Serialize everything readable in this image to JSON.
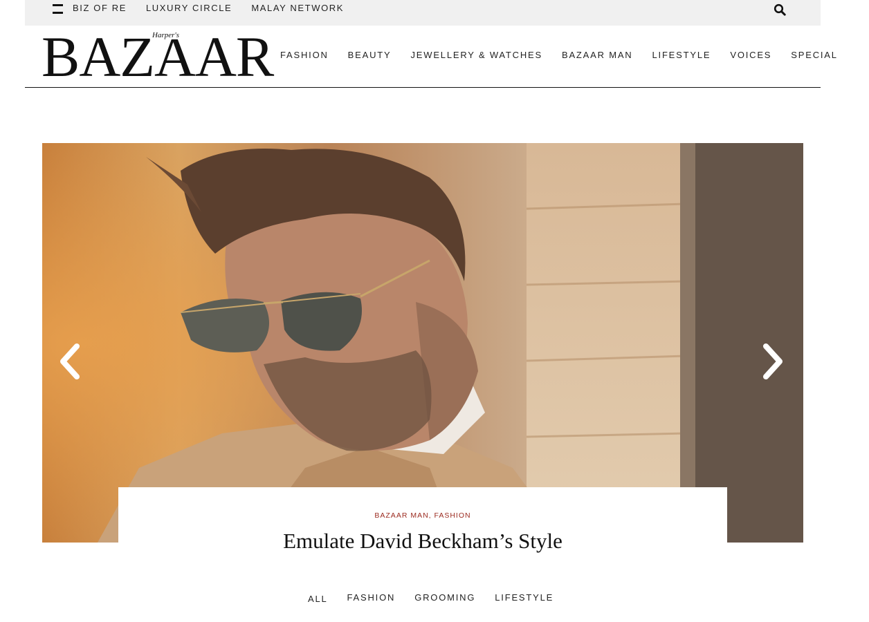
{
  "topbar": {
    "links": [
      "BIZ OF RE",
      "LUXURY CIRCLE",
      "MALAY NETWORK"
    ]
  },
  "logo": {
    "main": "BAZAAR",
    "sub": "Harper's"
  },
  "nav": {
    "items": [
      "FASHION",
      "BEAUTY",
      "JEWELLERY & WATCHES",
      "BAZAAR MAN",
      "LIFESTYLE",
      "VOICES",
      "SPECIAL"
    ]
  },
  "hero": {
    "categories": [
      "BAZAAR MAN",
      "FASHION"
    ],
    "category_separator": ",",
    "title": "Emulate David Beckham’s Style"
  },
  "filters": {
    "items": [
      "ALL",
      "FASHION",
      "GROOMING",
      "LIFESTYLE"
    ],
    "active": "ALL"
  },
  "colors": {
    "topbar_bg": "#f0f0f0",
    "category_accent": "#9b2a1f",
    "text": "#111111"
  },
  "icons": {
    "menu": "hamburger-menu-icon",
    "search": "search-icon",
    "prev": "chevron-left-icon",
    "next": "chevron-right-icon"
  }
}
